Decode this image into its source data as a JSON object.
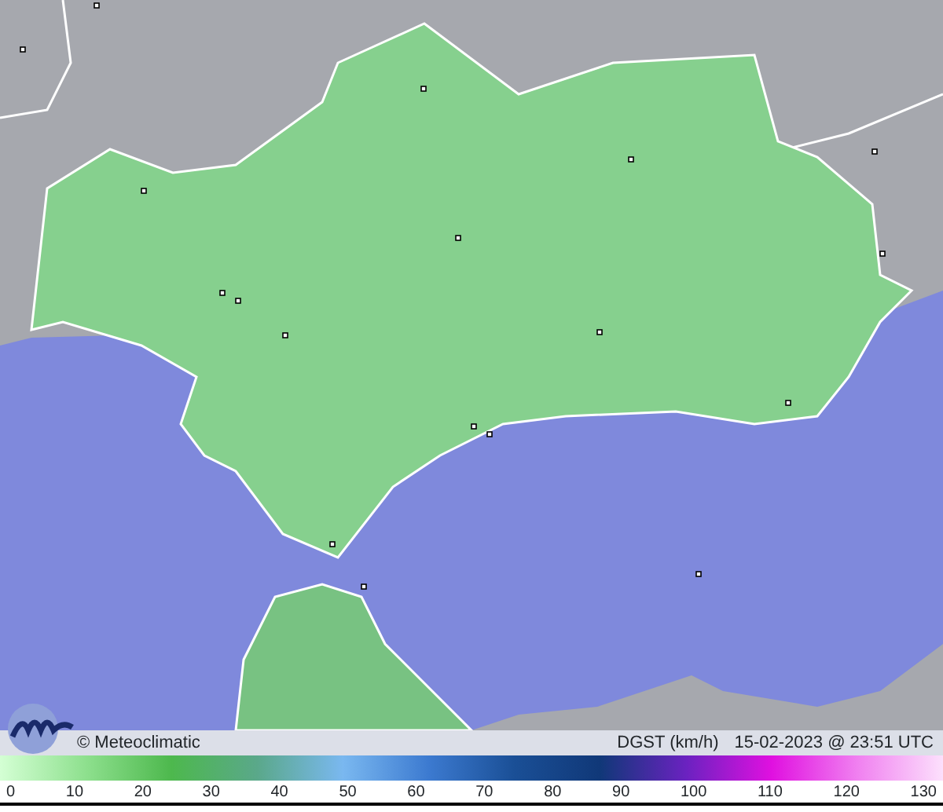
{
  "caption": {
    "credit": "© Meteoclimatic",
    "variable": "DGST (km/h)",
    "timestamp": "15-02-2023 @ 23:51 UTC"
  },
  "scale": {
    "ticks": [
      "0",
      "10",
      "20",
      "30",
      "40",
      "50",
      "60",
      "70",
      "80",
      "90",
      "100",
      "110",
      "120",
      "130"
    ]
  }
}
